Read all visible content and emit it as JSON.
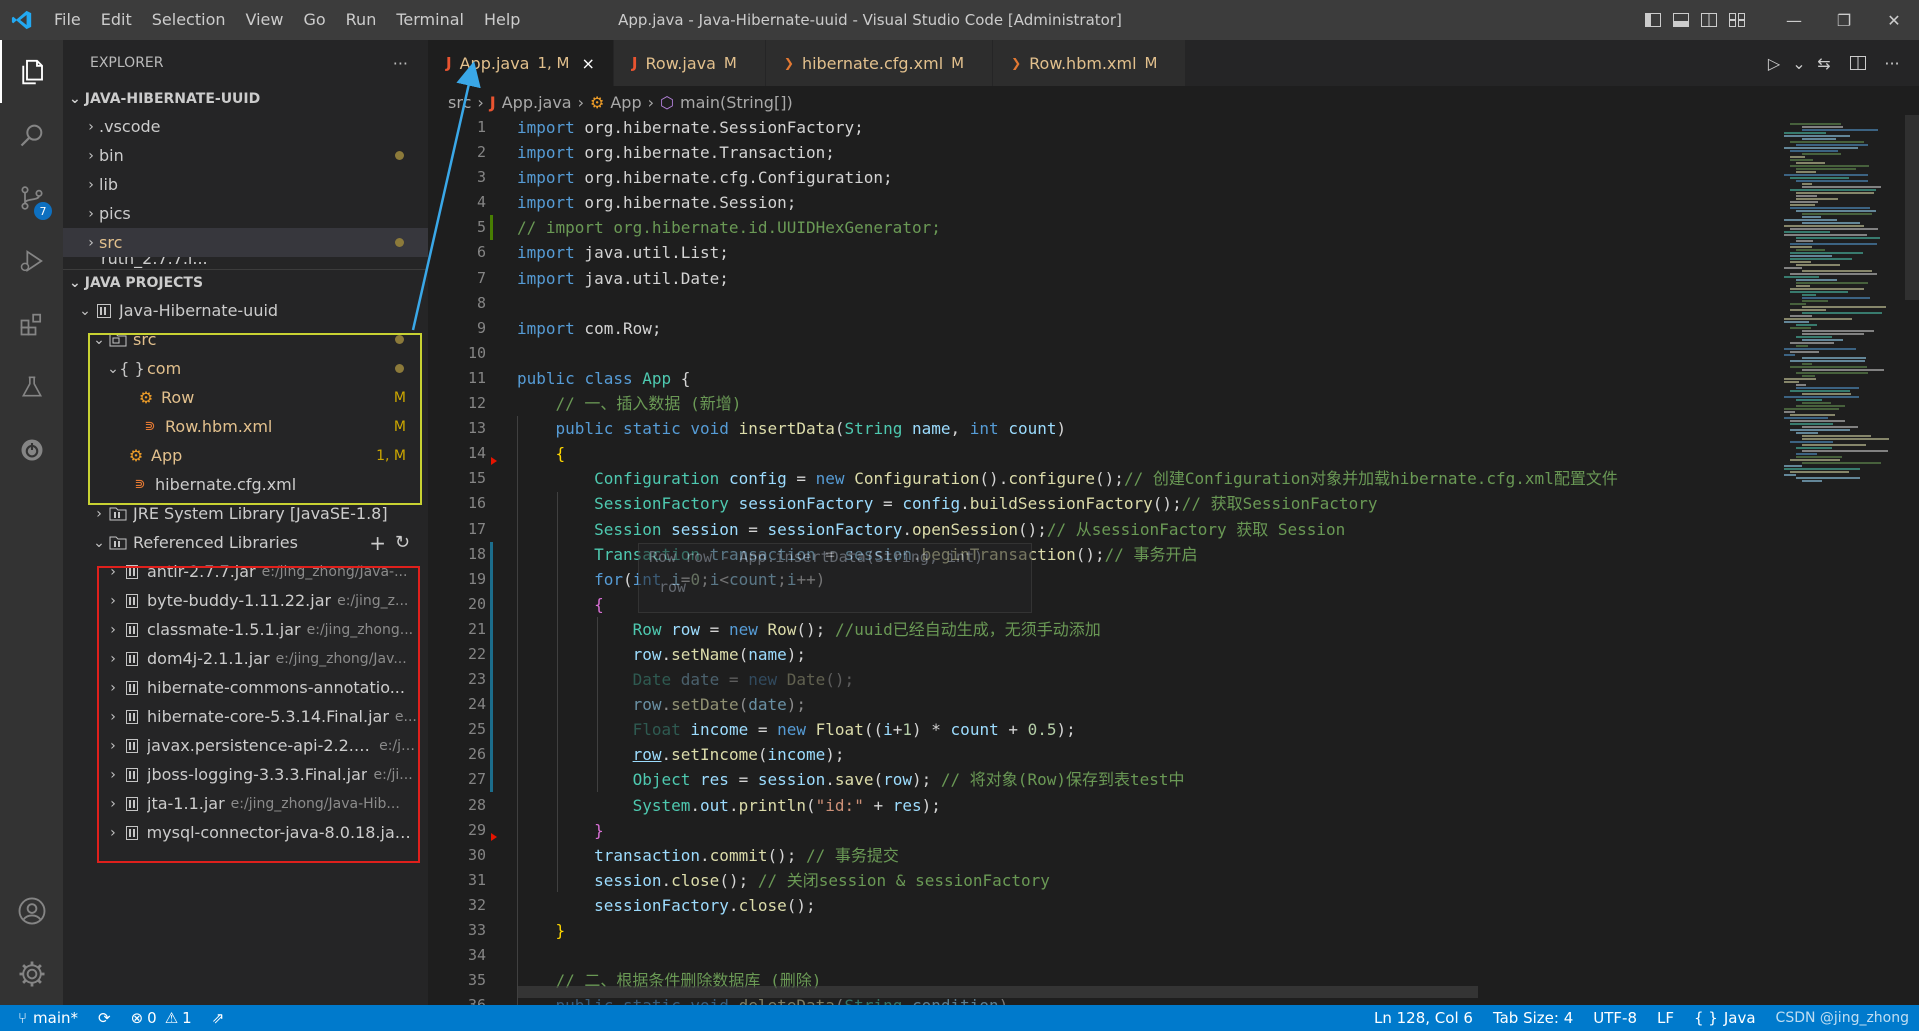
{
  "titlebar": {
    "menu": [
      "File",
      "Edit",
      "Selection",
      "View",
      "Go",
      "Run",
      "Terminal",
      "Help"
    ],
    "title": "App.java - Java-Hibernate-uuid - Visual Studio Code [Administrator]"
  },
  "activity": {
    "scm_badge": "7"
  },
  "sidebar": {
    "header": "EXPLORER",
    "more": "···",
    "workspace": {
      "title": "JAVA-HIBERNATE-UUID",
      "items": [
        {
          "label": ".vscode"
        },
        {
          "label": "bin"
        },
        {
          "label": "lib"
        },
        {
          "label": "pics"
        },
        {
          "label": "src"
        },
        {
          "label": "ruth_2.7.7.i..."
        }
      ]
    },
    "java_projects": {
      "title": "JAVA PROJECTS",
      "project": "Java-Hibernate-uuid",
      "src": "src",
      "package": "com",
      "files": [
        {
          "label": "Row",
          "status": "M"
        },
        {
          "label": "Row.hbm.xml",
          "status": "M"
        },
        {
          "label": "App",
          "status": "1, M"
        },
        {
          "label": "hibernate.cfg.xml",
          "status": ""
        }
      ],
      "jre": "JRE System Library [JavaSE-1.8]",
      "ref_libs": "Referenced Libraries",
      "jars": [
        {
          "name": "antlr-2.7.7.jar",
          "path": "e:/jing_zhong/Java-..."
        },
        {
          "name": "byte-buddy-1.11.22.jar",
          "path": "e:/jing_z..."
        },
        {
          "name": "classmate-1.5.1.jar",
          "path": "e:/jing_zhong..."
        },
        {
          "name": "dom4j-2.1.1.jar",
          "path": "e:/jing_zhong/Jav..."
        },
        {
          "name": "hibernate-commons-annotatio...",
          "path": ""
        },
        {
          "name": "hibernate-core-5.3.14.Final.jar",
          "path": "e..."
        },
        {
          "name": "javax.persistence-api-2.2.jar",
          "path": "e:/ji..."
        },
        {
          "name": "jboss-logging-3.3.3.Final.jar",
          "path": "e:/ji..."
        },
        {
          "name": "jta-1.1.jar",
          "path": "e:/jing_zhong/Java-Hib..."
        },
        {
          "name": "mysql-connector-java-8.0.18.jar...",
          "path": ""
        }
      ]
    }
  },
  "tabs": [
    {
      "icon": "J",
      "label": "App.java",
      "badge": "1, M",
      "close": "×"
    },
    {
      "icon": "J",
      "label": "Row.java",
      "badge": "M"
    },
    {
      "icon": "❯",
      "label": "hibernate.cfg.xml",
      "badge": "M"
    },
    {
      "icon": "❯",
      "label": "Row.hbm.xml",
      "badge": "M"
    }
  ],
  "breadcrumb": [
    "src",
    "App.java",
    "App",
    "main(String[])"
  ],
  "editor": {
    "line_numbers": [
      "1",
      "2",
      "3",
      "4",
      "5",
      "6",
      "7",
      "8",
      "9",
      "10",
      "11",
      "12",
      "13",
      "14",
      "15",
      "16",
      "17",
      "18",
      "19",
      "20",
      "21",
      "22",
      "23",
      "24",
      "25",
      "26",
      "27",
      "28",
      "29",
      "30",
      "31",
      "32",
      "33",
      "34",
      "35",
      "36"
    ],
    "hint": [
      "Row row - App.insertData(String, int)",
      "row"
    ]
  },
  "statusbar": {
    "branch": "main*",
    "errors": "0",
    "warnings": "1",
    "position": "Ln 128, Col 6",
    "tabsize": "Tab Size: 4",
    "encoding": "UTF-8",
    "eol": "LF",
    "language": "Java",
    "watermark": "CSDN @jing_zhong"
  },
  "colors": {
    "accent": "#007acc",
    "yellow_box": "#c8d232",
    "red_box": "#e0201c",
    "arrow": "#3aa8e8"
  }
}
